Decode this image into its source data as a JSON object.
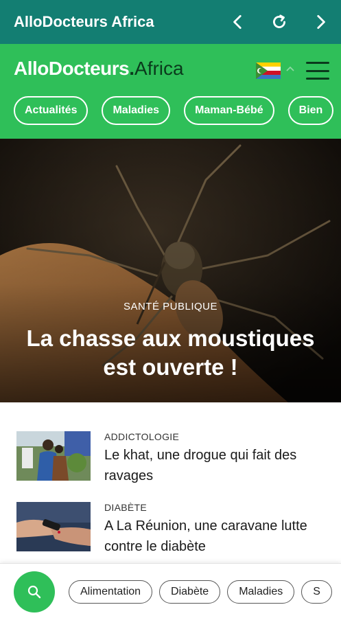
{
  "appbar": {
    "title": "AlloDocteurs Africa",
    "back_icon": "chevron-left-icon",
    "reload_icon": "reload-icon",
    "forward_icon": "chevron-right-icon",
    "color": "#137e72"
  },
  "header": {
    "logo_brand": "AlloDocteurs",
    "logo_dot": ".",
    "logo_region": "Africa",
    "flag_icon": "comoros-flag-icon",
    "menu_icon": "hamburger-menu-icon",
    "color": "#2fbf59",
    "categories": [
      "Actualités",
      "Maladies",
      "Maman-Bébé",
      "Bien"
    ]
  },
  "hero": {
    "kicker": "SANTÉ PUBLIQUE",
    "title": "La chasse aux moustiques est ouverte !"
  },
  "articles": [
    {
      "category": "ADDICTOLOGIE",
      "title": "Le khat, une drogue qui fait des ravages"
    },
    {
      "category": "DIABÈTE",
      "title": "A La Réunion, une caravane lutte contre le diabète"
    }
  ],
  "bottom": {
    "search_icon": "search-icon",
    "tags": [
      "Alimentation",
      "Diabète",
      "Maladies",
      "S"
    ]
  }
}
